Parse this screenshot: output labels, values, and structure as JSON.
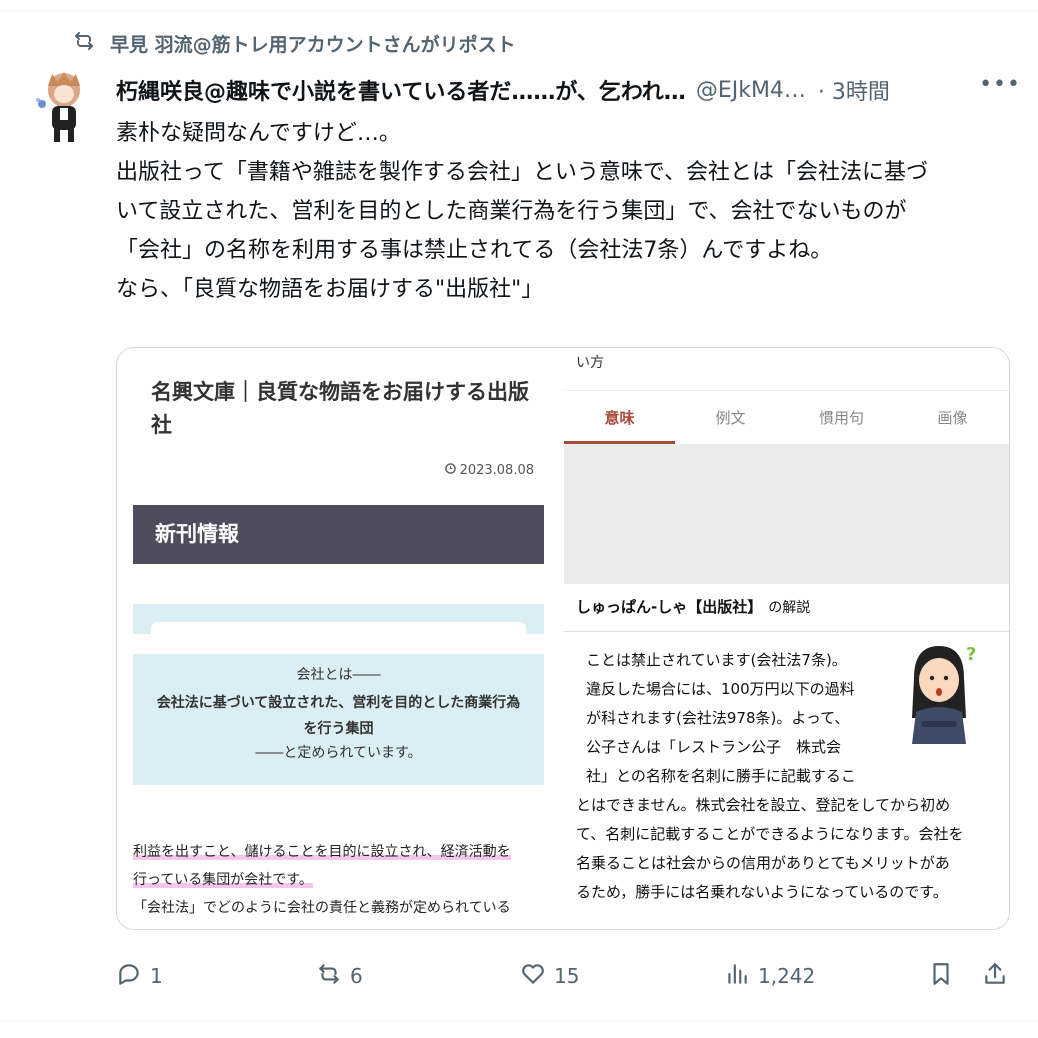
{
  "repost": {
    "text": "早見 羽流@筋トレ用アカウントさんがリポスト"
  },
  "tweet": {
    "author_name": "朽縄咲良@趣味で小説を書いている者だ……が、乞われ…",
    "handle": "@EJkM4…",
    "time": "· 3時間",
    "more": "•••",
    "lines": [
      "素朴な疑問なんですけど…。",
      "出版社って「書籍や雑誌を製作する会社」という意味で、会社とは「会社法に基づ",
      "いて設立された、営利を目的とした商業行為を行う集団」で、会社でないものが",
      "「会社」の名称を利用する事は禁止されてる（会社法7条）んですよね。",
      "なら、「良質な物語をお届けする\"出版社\"」"
    ]
  },
  "card": {
    "left": {
      "title": "名興文庫｜良質な物語をお届けする出版社",
      "date": "2023.08.08",
      "banner": "新刊情報",
      "def_line1": "会社とは――",
      "def_line2": "会社法に基づいて設立された、営利を目的とした商業行為",
      "def_line3": "を行う集団",
      "def_line4": "――と定められています。",
      "body_line1": "利益を出すこと、儲けることを目的に設立され、経済活動を",
      "body_line2": "行っている集団が会社です。",
      "body_line3": "「会社法」でどのように会社の責任と義務が定められている"
    },
    "right": {
      "top_text": "い方",
      "tabs": [
        "意味",
        "例文",
        "慣用句",
        "画像"
      ],
      "heading": "しゅっぱん-しゃ【出版社】",
      "heading_suffix": "の解説",
      "body": [
        "ことは禁止されています(会社法7条)。",
        "違反した場合には、100万円以下の過料",
        "が科されます(会社法978条)。よって、",
        "公子さんは「レストラン公子　株式会",
        "社」との名称を名刺に勝手に記載するこ",
        "とはできません。株式会社を設立、登記をしてから初め",
        "て、名刺に記載することができるようになります。会社を",
        "名乗ることは社会からの信用がありとてもメリットがあ",
        "るため，勝手には名乗れないようになっているのです。"
      ]
    }
  },
  "actions": {
    "replies": "1",
    "reposts": "6",
    "likes": "15",
    "views": "1,242"
  }
}
